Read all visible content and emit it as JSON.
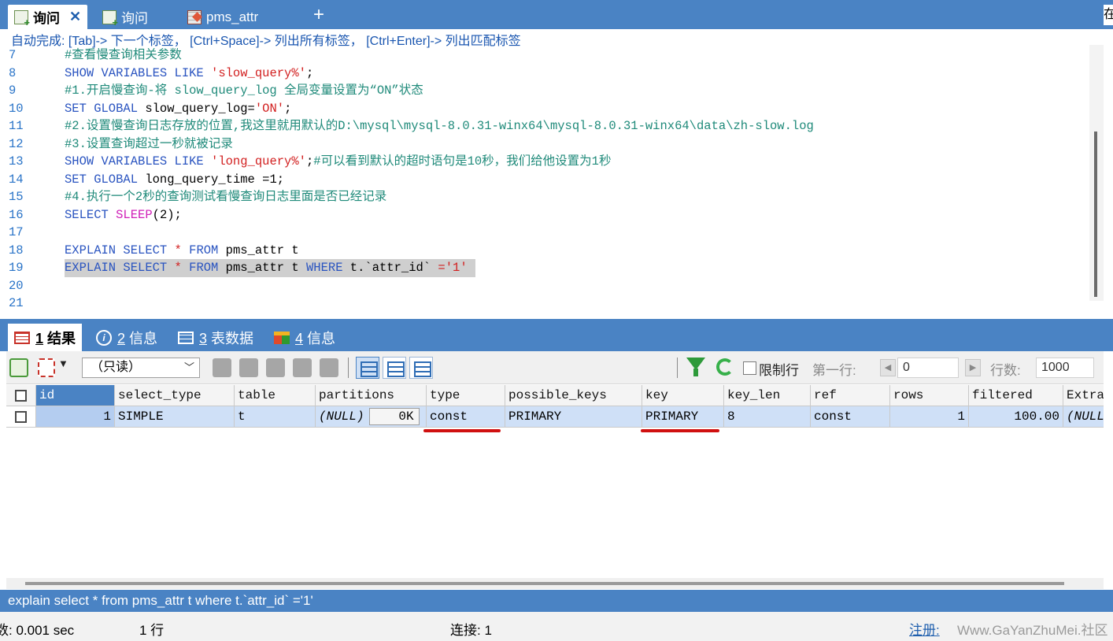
{
  "tabs": [
    {
      "label": "询问",
      "active": true,
      "icon": "query-icon"
    },
    {
      "label": "询问",
      "active": false,
      "icon": "query-icon"
    },
    {
      "label": "pms_attr",
      "active": false,
      "icon": "table-icon"
    }
  ],
  "new_tab_label": "+",
  "edge_char": "在",
  "editor": {
    "autocomplete_hint": "自动完成: [Tab]-> 下一个标签， [Ctrl+Space]-> 列出所有标签， [Ctrl+Enter]-> 列出匹配标签",
    "lines": [
      {
        "no": "7",
        "tokens": [
          {
            "t": "#查看慢查询相关参数",
            "c": "c"
          }
        ]
      },
      {
        "no": "8",
        "tokens": [
          {
            "t": "SHOW VARIABLES LIKE ",
            "c": "k"
          },
          {
            "t": "'slow_query%'",
            "c": "s"
          },
          {
            "t": ";",
            "c": "p"
          }
        ]
      },
      {
        "no": "9",
        "tokens": [
          {
            "t": "#1.开启慢查询-将 slow_query_log 全局变量设置为“ON”状态",
            "c": "c"
          }
        ]
      },
      {
        "no": "10",
        "tokens": [
          {
            "t": "SET GLOBAL ",
            "c": "k"
          },
          {
            "t": "slow_query_log=",
            "c": "p"
          },
          {
            "t": "'ON'",
            "c": "s"
          },
          {
            "t": ";",
            "c": "p"
          }
        ]
      },
      {
        "no": "11",
        "tokens": [
          {
            "t": "#2.设置慢查询日志存放的位置,我这里就用默认的D:\\mysql\\mysql-8.0.31-winx64\\mysql-8.0.31-winx64\\data\\zh-slow.log",
            "c": "c"
          }
        ]
      },
      {
        "no": "12",
        "tokens": [
          {
            "t": "#3.设置查询超过一秒就被记录",
            "c": "c"
          }
        ]
      },
      {
        "no": "13",
        "tokens": [
          {
            "t": "SHOW VARIABLES LIKE ",
            "c": "k"
          },
          {
            "t": "'long_query%'",
            "c": "s"
          },
          {
            "t": ";",
            "c": "p"
          },
          {
            "t": "#可以看到默认的超时语句是10秒，我们给他设置为1秒",
            "c": "c"
          }
        ]
      },
      {
        "no": "14",
        "tokens": [
          {
            "t": "SET GLOBAL ",
            "c": "k"
          },
          {
            "t": "long_query_time =1;",
            "c": "p"
          }
        ]
      },
      {
        "no": "15",
        "tokens": [
          {
            "t": "#4.执行一个2秒的查询测试看慢查询日志里面是否已经记录",
            "c": "c"
          }
        ]
      },
      {
        "no": "16",
        "tokens": [
          {
            "t": "SELECT ",
            "c": "k"
          },
          {
            "t": "SLEEP",
            "c": "f"
          },
          {
            "t": "(2);",
            "c": "p"
          }
        ]
      },
      {
        "no": "17",
        "tokens": []
      },
      {
        "no": "18",
        "tokens": [
          {
            "t": "EXPLAIN SELECT ",
            "c": "k"
          },
          {
            "t": "* ",
            "c": "s"
          },
          {
            "t": "FROM ",
            "c": "k"
          },
          {
            "t": "pms_attr t",
            "c": "p"
          }
        ]
      },
      {
        "no": "19",
        "selected": true,
        "tokens": [
          {
            "t": "EXPLAIN SELECT ",
            "c": "k"
          },
          {
            "t": "* ",
            "c": "s"
          },
          {
            "t": "FROM ",
            "c": "k"
          },
          {
            "t": "pms_attr t ",
            "c": "p"
          },
          {
            "t": "WHERE ",
            "c": "k"
          },
          {
            "t": "t.`attr_id` ",
            "c": "p"
          },
          {
            "t": "=",
            "c": "s"
          },
          {
            "t": "'1'",
            "c": "s"
          }
        ]
      },
      {
        "no": "20",
        "tokens": []
      },
      {
        "no": "21",
        "tokens": []
      }
    ]
  },
  "result_tabs": [
    {
      "num": "1",
      "label": "结果",
      "active": true,
      "icon": "result-grid-icon"
    },
    {
      "num": "2",
      "label": "信息",
      "active": false,
      "icon": "info-icon"
    },
    {
      "num": "3",
      "label": "表数据",
      "active": false,
      "icon": "table-data-icon"
    },
    {
      "num": "4",
      "label": "信息",
      "active": false,
      "icon": "info-box-icon"
    }
  ],
  "toolbar": {
    "readonly_select": "（只读）",
    "limit_rows_label": "限制行",
    "first_row_label": "第一行:",
    "first_row_value": "0",
    "rows_label": "行数:",
    "rows_value": "1000"
  },
  "grid": {
    "columns": [
      "id",
      "select_type",
      "table",
      "partitions",
      "type",
      "possible_keys",
      "key",
      "key_len",
      "ref",
      "rows",
      "filtered",
      "Extra"
    ],
    "rows": [
      {
        "id": "1",
        "select_type": "SIMPLE",
        "table": "t",
        "partitions": "(NULL)",
        "partitions_btn": "0K",
        "type": "const",
        "possible_keys": "PRIMARY",
        "key": "PRIMARY",
        "key_len": "8",
        "ref": "const",
        "rows": "1",
        "filtered": "100.00",
        "Extra": "(NULL)"
      }
    ]
  },
  "sql_status": "explain select * from pms_attr t where t.`attr_id` ='1'",
  "statusbar": {
    "exec_time": "数: 0.001 sec",
    "row_count": "1 行",
    "connection": "连接: 1",
    "register": "注册:",
    "watermark": "Www.GaYanZhuMei.社区"
  },
  "colors": {
    "accent_blue": "#4a83c4",
    "comment": "#1f8a7a",
    "keyword": "#2a54c0",
    "string": "#d22020",
    "function": "#d01fb8",
    "annotation_red": "#d01010"
  }
}
